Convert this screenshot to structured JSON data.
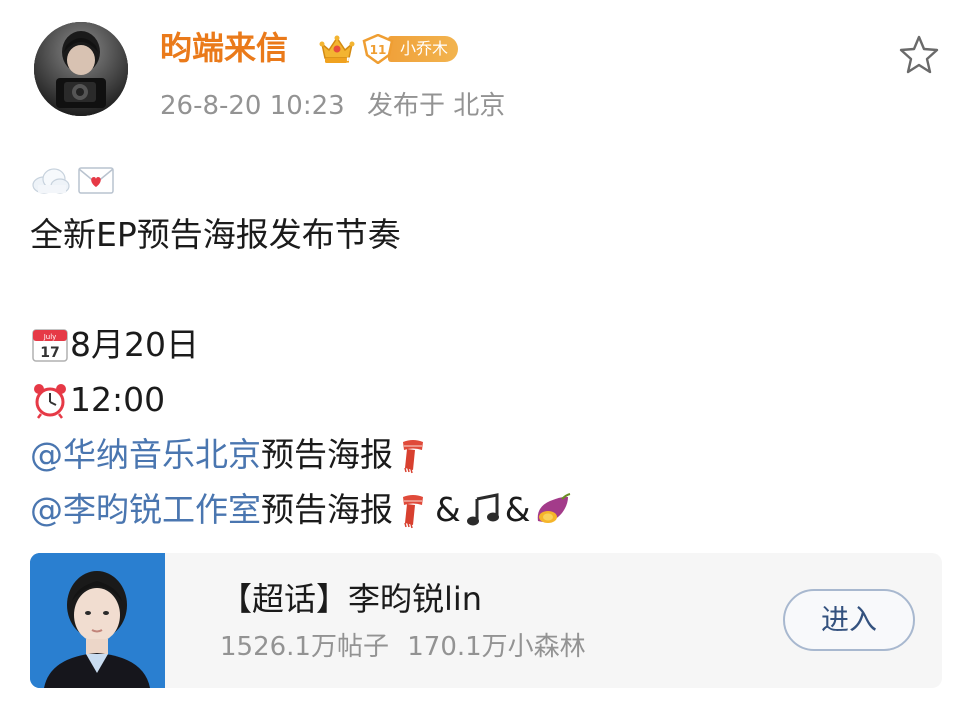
{
  "post": {
    "author": {
      "name": "昀端来信",
      "level_badge": "11",
      "fan_label": "小乔木",
      "avatar_icon": "avatar-photo"
    },
    "time": "26-8-20 10:23",
    "location": "发布于 北京",
    "icons": {
      "vip": "crown-icon",
      "favorite": "star-icon"
    },
    "lines": {
      "emoji_row": [
        "cloud-emoji",
        "love-letter-emoji"
      ],
      "headline": "全新EP预告海报发布节奏",
      "date": "8月20日",
      "time": "12:00",
      "mention_1": "@华纳音乐北京",
      "mention_1_text": " 预告海报",
      "mention_2": "@李昀锐工作室",
      "mention_2_text": " 预告海报",
      "amp": "&"
    }
  },
  "topic_card": {
    "title": "【超话】李昀锐lin",
    "posts": "1526.1万帖子",
    "members": "170.1万小森林",
    "enter_label": "进入"
  },
  "colors": {
    "username": "#ea7a1a",
    "mention": "#4a76b0",
    "meta": "#939393",
    "badge": "#f0a13a"
  }
}
